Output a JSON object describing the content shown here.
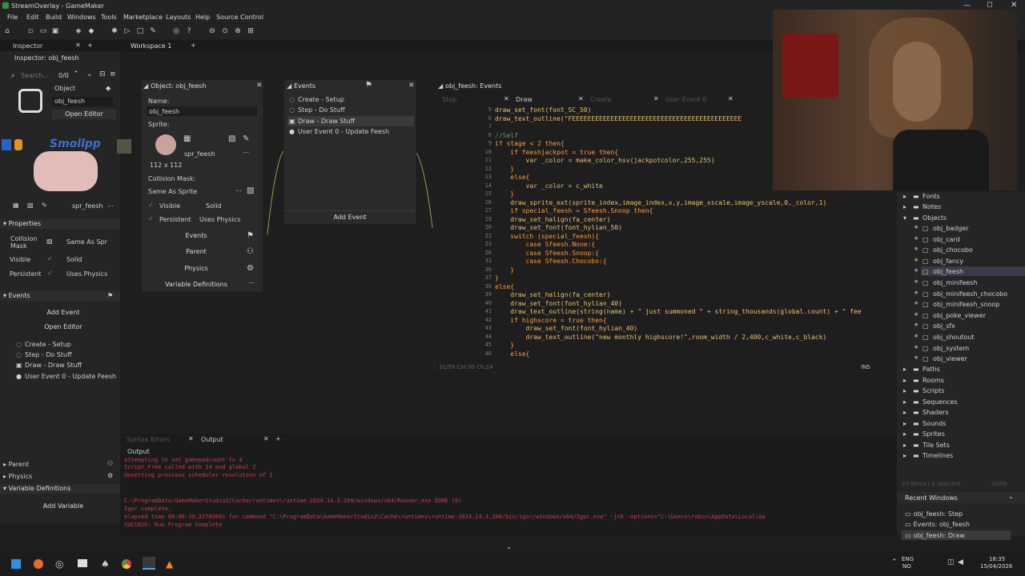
{
  "window": {
    "title": "StreamOverlay - GameMaker"
  },
  "menu": [
    "File",
    "Edit",
    "Build",
    "Windows",
    "Tools",
    "Marketplace",
    "Layouts",
    "Help",
    "Source Control"
  ],
  "tabs": {
    "inspector": "Inspector",
    "workspace": "Workspace 1",
    "plus": "+"
  },
  "inspector": {
    "title": "Inspector: obj_feesh",
    "search_placeholder": "Search...",
    "count": "0/0",
    "type_label": "Object",
    "name_value": "obj_feesh",
    "open_editor": "Open Editor",
    "overlay_text": "Smollpp",
    "sprite_name": "spr_feesh",
    "properties_header": "Properties",
    "collision_label": "Collision Mask",
    "collision_value": "Same As Spr",
    "visible_label": "Visible",
    "solid_label": "Solid",
    "persistent_label": "Persistent",
    "uses_physics_label": "Uses Physics",
    "events_header": "Events",
    "add_event": "Add Event",
    "open_editor2": "Open Editor",
    "events": [
      "Create - Setup",
      "Step - Do Stuff",
      "Draw - Draw Stuff",
      "User Event 0 - Update Feesh"
    ],
    "parent_header": "Parent",
    "physics_header": "Physics",
    "vardefs_header": "Variable Definitions",
    "add_variable": "Add Variable"
  },
  "object_window": {
    "title": "Object: obj_feesh",
    "name_label": "Name:",
    "name_value": "obj_feesh",
    "sprite_label": "Sprite:",
    "sprite_name": "spr_feesh",
    "sprite_size": "112 x 112",
    "collision_label": "Collision Mask:",
    "collision_value": "Same As Sprite",
    "visible": "Visible",
    "solid": "Solid",
    "persistent": "Persistent",
    "uses_physics": "Uses Physics",
    "events_btn": "Events",
    "parent_btn": "Parent",
    "physics_btn": "Physics",
    "vardefs_btn": "Variable Definitions"
  },
  "events_window": {
    "title": "Events",
    "items": [
      "Create - Setup",
      "Step - Do Stuff",
      "Draw - Draw Stuff",
      "User Event 0 - Update Feesh"
    ],
    "add_event": "Add Event"
  },
  "code_window": {
    "title": "obj_feesh: Events",
    "tabs": [
      "Step",
      "Draw",
      "Create",
      "User Event 0"
    ],
    "status_left": "31/59 Col:30 Ch:24",
    "status_right": "INS",
    "lines": [
      {
        "n": "5",
        "t": "draw_set_font(font_SC_50)"
      },
      {
        "n": "6",
        "t": "draw_text_outline(\"FEEEEEEEEEEEEEEEEEEEEEEEEEEEEEEEEEEEEEEEEEEEE"
      },
      {
        "n": "7",
        "t": ""
      },
      {
        "n": "8",
        "t": "//Self"
      },
      {
        "n": "9",
        "t": "if stage < 2 then{"
      },
      {
        "n": "10",
        "t": "    if feeshjackpot = true then{"
      },
      {
        "n": "11",
        "t": "        var _color = make_color_hsv(jackpotcolor,255,255)"
      },
      {
        "n": "12",
        "t": "    }"
      },
      {
        "n": "13",
        "t": "    else{"
      },
      {
        "n": "14",
        "t": "        var _color = c_white"
      },
      {
        "n": "15",
        "t": "    }"
      },
      {
        "n": "16",
        "t": "    draw_sprite_ext(sprite_index,image_index,x,y,image_xscale,image_yscale,0,_color,1)"
      },
      {
        "n": "17",
        "t": "    if special_feesh = Sfeesh.Snoop then{"
      },
      {
        "n": "19",
        "t": "    draw_set_halign(fa_center)"
      },
      {
        "n": "20",
        "t": "    draw_set_font(font_hylian_50)"
      },
      {
        "n": "22",
        "t": "    switch (special_feesh){"
      },
      {
        "n": "23",
        "t": "        case Sfeesh.None:{"
      },
      {
        "n": "26",
        "t": "        case Sfeesh.Snoop:{"
      },
      {
        "n": "31",
        "t": "        case Sfeesh.Chocobo:{"
      },
      {
        "n": "36",
        "t": "    }"
      },
      {
        "n": "37",
        "t": "}"
      },
      {
        "n": "38",
        "t": "else{"
      },
      {
        "n": "39",
        "t": "    draw_set_halign(fa_center)"
      },
      {
        "n": "40",
        "t": "    draw_set_font(font_hylian_40)"
      },
      {
        "n": "41",
        "t": "    draw_text_outline(string(name) + \" just summoned \" + string_thousands(global.count) + \" fee"
      },
      {
        "n": "42",
        "t": "    if highscore = true then{"
      },
      {
        "n": "43",
        "t": "        draw_set_font(font_hylian_40)"
      },
      {
        "n": "44",
        "t": "        draw_text_outline(\"new monthly highscore!\",room_width / 2,400,c_white,c_black)"
      },
      {
        "n": "45",
        "t": "    }"
      },
      {
        "n": "46",
        "t": "    else{"
      }
    ]
  },
  "asset_browser": {
    "folders_top": [
      "Fonts",
      "Notes",
      "Objects"
    ],
    "objects": [
      "obj_badger",
      "obj_card",
      "obj_chocobo",
      "obj_fancy",
      "obj_feesh",
      "obj_minifeesh",
      "obj_minifeesh_chocobo",
      "obj_minifeesh_snoop",
      "obj_poke_viewer",
      "obj_sfx",
      "obj_shoutout",
      "obj_system",
      "obj_viewer"
    ],
    "folders_bottom": [
      "Paths",
      "Rooms",
      "Scripts",
      "Sequences",
      "Shaders",
      "Sounds",
      "Sprites",
      "Tile Sets",
      "Timelines"
    ],
    "footer": "27 items | 1 selected",
    "zoom": "100%",
    "recent_header": "Recent Windows",
    "recent": [
      "obj_feesh: Step",
      "Events: obj_feesh",
      "obj_feesh: Draw"
    ]
  },
  "output": {
    "tab_syntax": "Syntax Errors",
    "tab_output": "Output",
    "header": "Output",
    "lines": [
      "Attempting to set gamepadcount to 4",
      "Script_Free called with 14 and global 2",
      "Unsetting previous scheduler resolution of 1",
      "",
      "",
      "C:\\ProgramData/GameMakerStudio2/Cache/runtimes\\runtime-2024.14.3.260/windows/x64/Runner.exe DONE (0)",
      "Igor complete.",
      "elapsed time 00:00:39.2278989s for command \"C:\\ProgramData\\GameMakerStudio2\\Cache\\runtimes\\runtime-2024.14.3.260/bin/igor/windows/x64/Igor.exe\" -j=8  -options=\"C:\\Users\\robin\\AppData\\Local\\Ga",
      "SUCCESS: Run Program Complete"
    ]
  },
  "taskbar": {
    "lang1": "ENG",
    "lang2": "NO",
    "time": "18:35",
    "date": "15/04/2026"
  }
}
